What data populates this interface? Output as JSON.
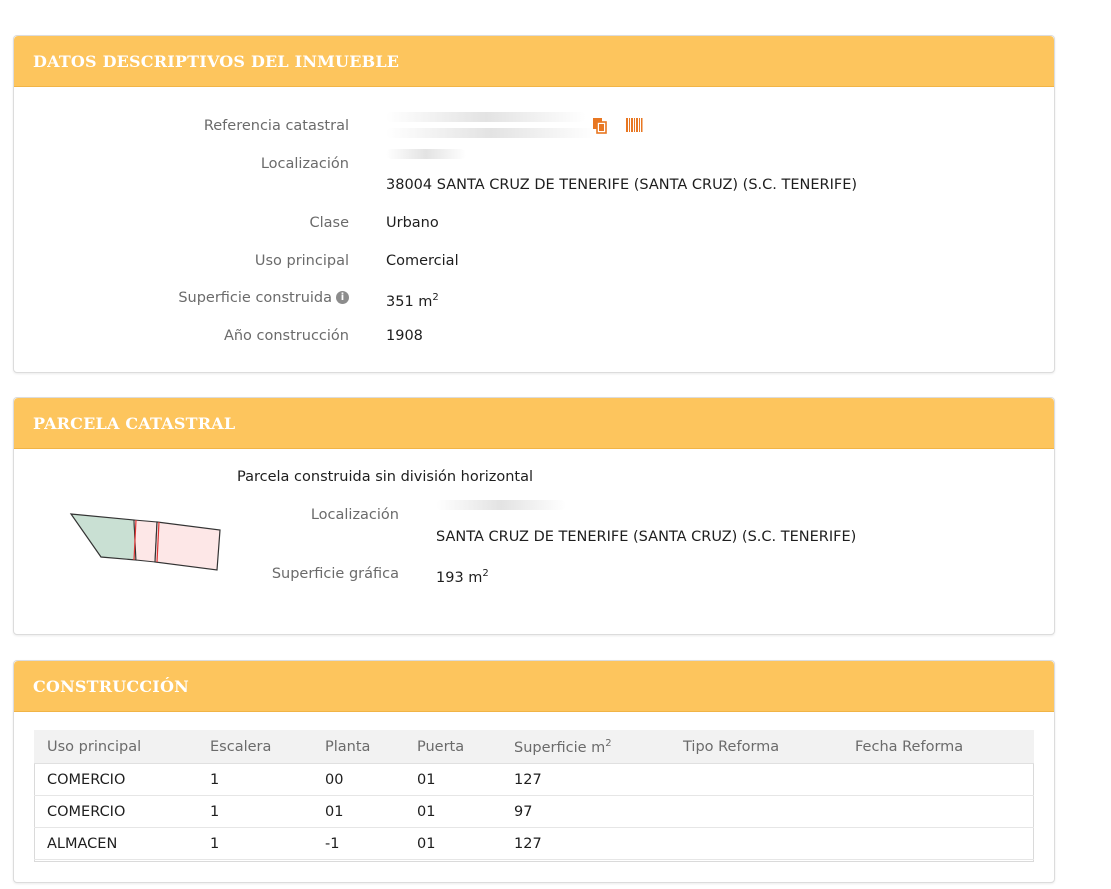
{
  "datos": {
    "title": "DATOS DESCRIPTIVOS DEL INMUEBLE",
    "referencia_label": "Referencia catastral",
    "localizacion_label": "Localización",
    "localizacion_value": "38004 SANTA CRUZ DE TENERIFE (SANTA CRUZ) (S.C. TENERIFE)",
    "clase_label": "Clase",
    "clase_value": "Urbano",
    "uso_label": "Uso principal",
    "uso_value": "Comercial",
    "superficie_label": "Superficie construida",
    "superficie_value": "351 m",
    "superficie_sup": "2",
    "info_glyph": "i",
    "anio_label": "Año construcción",
    "anio_value": "1908",
    "icons": [
      "copy-icon",
      "barcode-icon"
    ],
    "icon_color": "#e87722"
  },
  "parcela": {
    "title": "PARCELA CATASTRAL",
    "subtitle": "Parcela construida sin división horizontal",
    "localizacion_label": "Localización",
    "localizacion_value": "SANTA CRUZ DE TENERIFE (SANTA CRUZ) (S.C. TENERIFE)",
    "superficie_label": "Superficie gráfica",
    "superficie_value": "193 m",
    "superficie_sup": "2"
  },
  "construccion": {
    "title": "CONSTRUCCIÓN",
    "headers": [
      "Uso principal",
      "Escalera",
      "Planta",
      "Puerta",
      "Superficie m",
      "Tipo Reforma",
      "Fecha Reforma"
    ],
    "header_sup": "2",
    "rows": [
      [
        "COMERCIO",
        "1",
        "00",
        "01",
        "127",
        "",
        ""
      ],
      [
        "COMERCIO",
        "1",
        "01",
        "01",
        "97",
        "",
        ""
      ],
      [
        "ALMACEN",
        "1",
        "-1",
        "01",
        "127",
        "",
        ""
      ]
    ]
  },
  "colors": {
    "header_bg": "#fdc55d",
    "header_text": "#ffffff",
    "label_text": "#6b6b6b"
  }
}
